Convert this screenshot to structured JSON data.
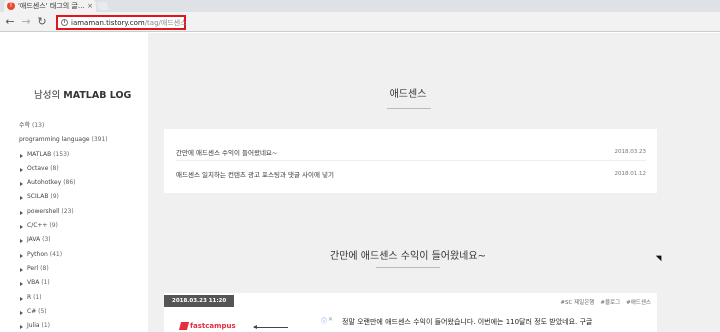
{
  "browser": {
    "tab_title": "'애드센스' 태그의 글 목록",
    "tab_favicon": "T",
    "tab_close": "×",
    "back_icon": "←",
    "forward_icon": "→",
    "reload_icon": "↻",
    "address_host": "iamaman.tistory.com",
    "address_path": "/tag/애드센스"
  },
  "sidebar": {
    "blog_title_prefix": "남성의 ",
    "blog_title_bold": "MATLAB LOG",
    "categories": [
      {
        "name": "수학",
        "count": "(13)"
      },
      {
        "name": "programming language",
        "count": "(391)"
      },
      {
        "name": "MATLAB",
        "count": "(153)"
      },
      {
        "name": "Octave",
        "count": "(8)"
      },
      {
        "name": "Autohotkey",
        "count": "(86)"
      },
      {
        "name": "SCILAB",
        "count": "(9)"
      },
      {
        "name": "powershell",
        "count": "(23)"
      },
      {
        "name": "C/C++",
        "count": "(9)"
      },
      {
        "name": "JAVA",
        "count": "(3)"
      },
      {
        "name": "Python",
        "count": "(41)"
      },
      {
        "name": "Perl",
        "count": "(8)"
      },
      {
        "name": "VBA",
        "count": "(1)"
      },
      {
        "name": "R",
        "count": "(1)"
      },
      {
        "name": "C#",
        "count": "(5)"
      },
      {
        "name": "Julia",
        "count": "(1)"
      }
    ]
  },
  "main": {
    "tag_heading": "애드센스",
    "posts": [
      {
        "title": "간만에 애드센스 수익이 들어왔네요~",
        "date": "2018.03.23"
      },
      {
        "title": "애드센스 일치하는 컨텐츠 광고 포스팅과 댓글 사이에 넣기",
        "date": "2018.01.12"
      }
    ],
    "article": {
      "heading": "간만에 애드센스 수익이 들어왔네요~",
      "date": "2018.03.23 11:20",
      "tags": [
        "#SC 제일은행",
        "#블로그",
        "#애드센스"
      ],
      "ad_logo": "fastcampus",
      "ad_choice_i": "ⓘ",
      "ad_choice_x": "✕",
      "text": "정말 오랜만에 애드센스 수익이 들어왔습니다. 이번에는 110달러 정도 받았네요. 구글"
    }
  },
  "colors": {
    "highlight_box": "#e0161f",
    "main_bg": "#f0f0f0",
    "date_badge": "#555555",
    "ad_logo": "#e62e3f"
  },
  "icons": {
    "favicon": "tistory-icon",
    "info": "info-icon",
    "category_bullet": "triangle-right-icon"
  }
}
